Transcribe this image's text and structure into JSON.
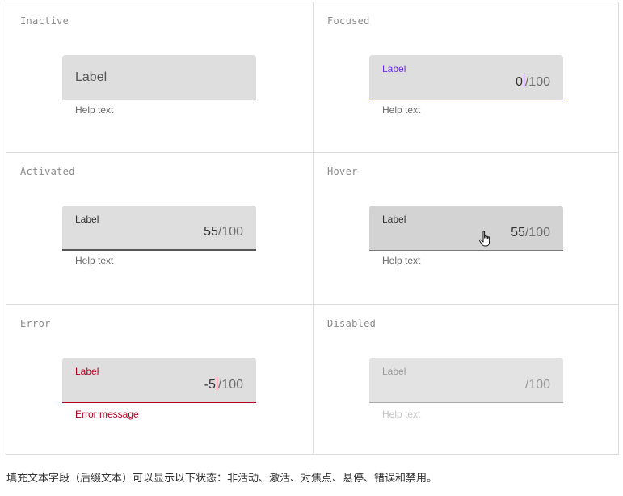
{
  "states": {
    "inactive": {
      "title": "Inactive",
      "label": "Label",
      "help": "Help text"
    },
    "focused": {
      "title": "Focused",
      "label": "Label",
      "value": "0",
      "suffix": "/100",
      "help": "Help text"
    },
    "activated": {
      "title": "Activated",
      "label": "Label",
      "value": "55",
      "suffix": "/100",
      "help": "Help text"
    },
    "hover": {
      "title": "Hover",
      "label": "Label",
      "value": "55",
      "suffix": "/100",
      "help": "Help text"
    },
    "error": {
      "title": "Error",
      "label": "Label",
      "value": "-5",
      "suffix": "/100",
      "help": "Error message"
    },
    "disabled": {
      "title": "Disabled",
      "label": "Label",
      "suffix": "/100",
      "help": "Help text"
    }
  },
  "caption": "填充文本字段（后缀文本）可以显示以下状态：非活动、激活、对焦点、悬停、错误和禁用。",
  "colors": {
    "focus": "#6a2ee6",
    "error": "#b00020",
    "field_bg": "#dedede"
  },
  "icons": {
    "cursor": "hand-pointer-icon"
  }
}
